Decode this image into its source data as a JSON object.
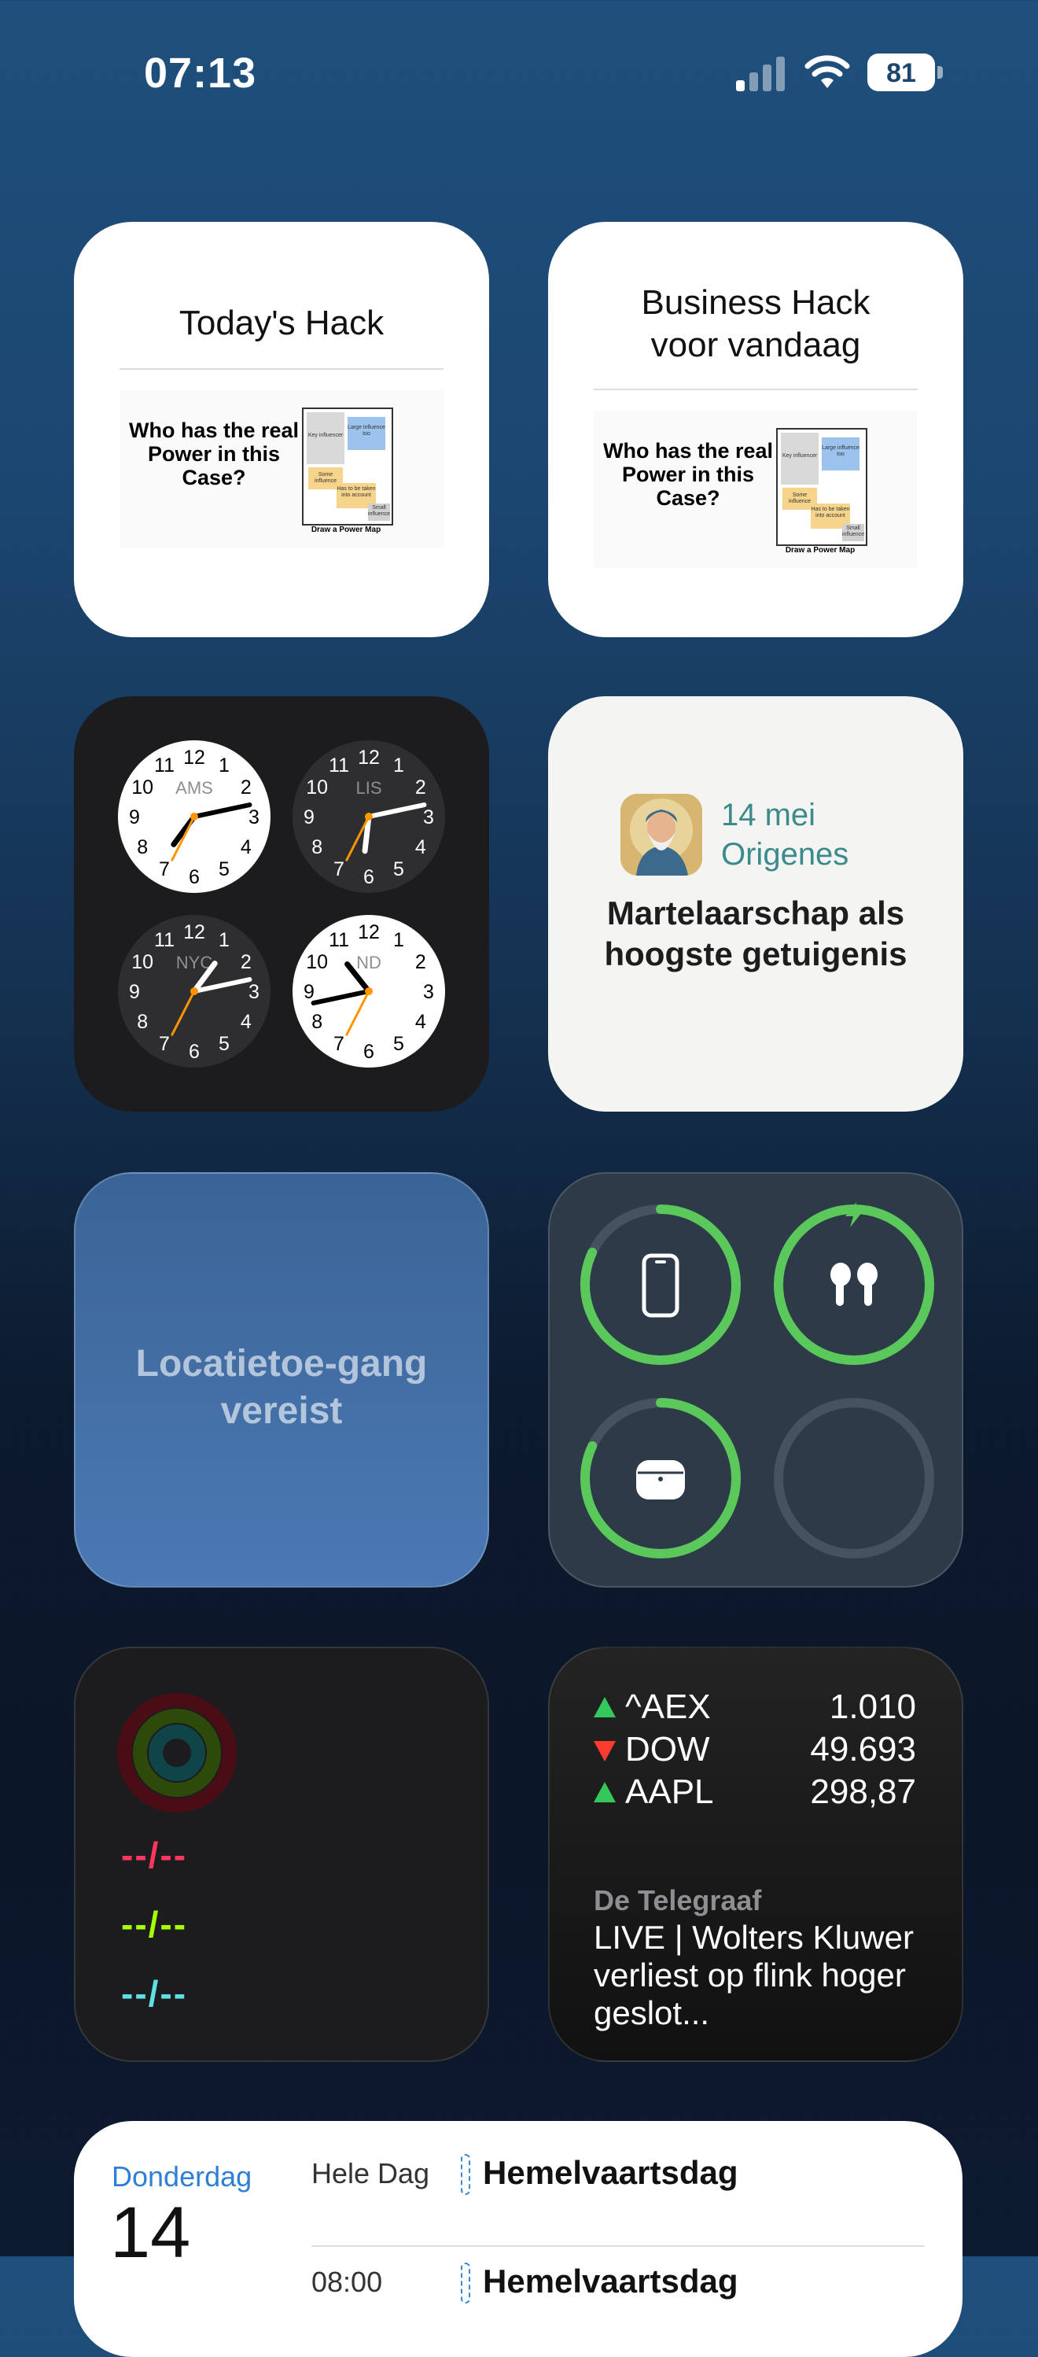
{
  "status_bar": {
    "time": "07:13",
    "battery": "81"
  },
  "widgets": {
    "hack_en": {
      "title": "Today's Hack",
      "image_question": "Who has the real Power in this Case?",
      "image_caption": "Draw a Power Map",
      "map_labels": [
        "Key influencer",
        "Large influence too",
        "Some influence",
        "Has to be taken into account",
        "Small influence"
      ]
    },
    "hack_nl": {
      "title_line1": "Business Hack",
      "title_line2": "voor vandaag",
      "image_question": "Who has the real Power in this Case?",
      "image_caption": "Draw a Power Map",
      "map_labels": [
        "Key influencer",
        "Large influence too",
        "Some influence",
        "Has to be taken into account",
        "Small influence"
      ]
    },
    "world_clock": {
      "clocks": [
        {
          "city": "AMS",
          "theme": "day",
          "hour": 7,
          "minute": 13
        },
        {
          "city": "LIS",
          "theme": "night",
          "hour": 6,
          "minute": 13
        },
        {
          "city": "NYC",
          "theme": "night",
          "hour": 1,
          "minute": 13
        },
        {
          "city": "ND",
          "theme": "day",
          "hour": 10,
          "minute": 43
        }
      ]
    },
    "saint": {
      "date": "14 mei",
      "name": "Origenes",
      "quote": "Martelaarschap als hoogste getuigenis"
    },
    "weather": {
      "message": "Locatietoe-gang vereist"
    },
    "batteries": {
      "devices": [
        {
          "icon": "iphone-icon",
          "level": 0.82,
          "charging": false
        },
        {
          "icon": "airpods-icon",
          "level": 1.0,
          "charging": true
        },
        {
          "icon": "airpods-case-icon",
          "level": 0.82,
          "charging": false
        },
        {
          "icon": "empty-slot",
          "level": 0,
          "charging": false
        }
      ],
      "ring_color": "#5ac85a"
    },
    "fitness": {
      "move": "--/--",
      "exercise": "--/--",
      "stand": "--/--",
      "colors": {
        "move": "#ff375f",
        "exercise": "#a6ff00",
        "stand": "#5ce1e6"
      }
    },
    "stocks": {
      "rows": [
        {
          "symbol": "^AEX",
          "value": "1.010",
          "direction": "up"
        },
        {
          "symbol": "DOW",
          "value": "49.693",
          "direction": "down"
        },
        {
          "symbol": "AAPL",
          "value": "298,87",
          "direction": "up"
        }
      ],
      "news_source": "De Telegraaf",
      "news_headline": "LIVE | Wolters Kluwer verliest op flink hoger geslot..."
    }
  },
  "calendar": {
    "weekday": "Donderdag",
    "day": "14",
    "events": [
      {
        "time": "Hele Dag",
        "title": "Hemelvaartsdag"
      },
      {
        "time": "08:00",
        "title": "Hemelvaartsdag"
      }
    ]
  }
}
